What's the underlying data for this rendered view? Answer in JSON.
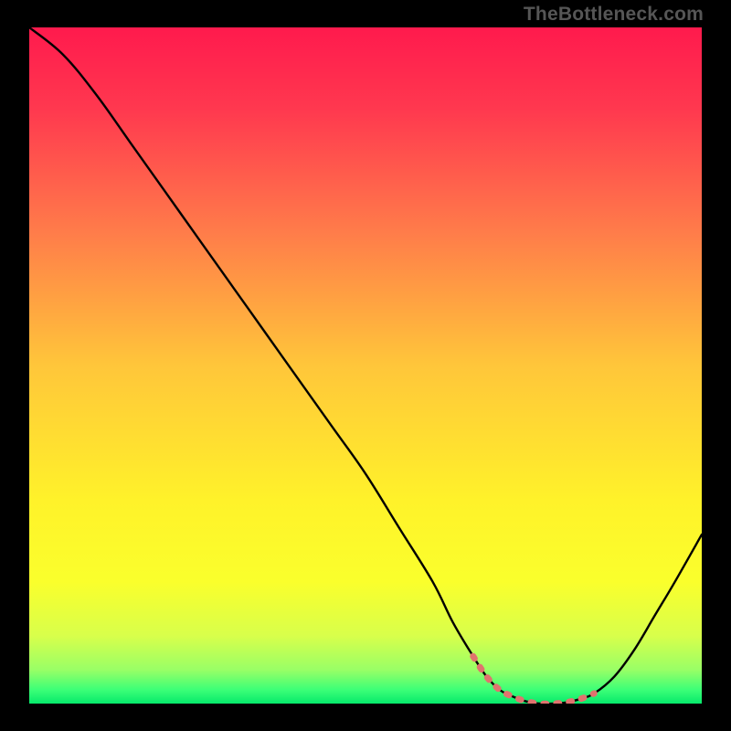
{
  "attribution": "TheBottleneck.com",
  "chart_data": {
    "type": "line",
    "title": "",
    "xlabel": "",
    "ylabel": "",
    "xlim": [
      0,
      100
    ],
    "ylim": [
      0,
      100
    ],
    "series": [
      {
        "name": "bottleneck-curve",
        "x": [
          0,
          5,
          10,
          15,
          20,
          25,
          30,
          35,
          40,
          45,
          50,
          55,
          60,
          63,
          66,
          68,
          70,
          72,
          74,
          76,
          78,
          80,
          82,
          84,
          87,
          90,
          93,
          96,
          100
        ],
        "y": [
          100,
          96,
          90,
          83,
          76,
          69,
          62,
          55,
          48,
          41,
          34,
          26,
          18,
          12,
          7,
          4,
          2,
          1,
          0.3,
          0,
          0,
          0.2,
          0.7,
          1.5,
          4,
          8,
          13,
          18,
          25
        ]
      },
      {
        "name": "highlight-band",
        "x": [
          66,
          68,
          70,
          72,
          74,
          76,
          78,
          80,
          82,
          84
        ],
        "y": [
          7,
          4,
          2,
          1,
          0.3,
          0,
          0,
          0.2,
          0.7,
          1.5
        ]
      }
    ],
    "gradient_stops": [
      {
        "offset": 0.0,
        "color": "#ff1a4d"
      },
      {
        "offset": 0.12,
        "color": "#ff384f"
      },
      {
        "offset": 0.3,
        "color": "#ff7b4a"
      },
      {
        "offset": 0.5,
        "color": "#ffc63a"
      },
      {
        "offset": 0.7,
        "color": "#fff22a"
      },
      {
        "offset": 0.82,
        "color": "#faff2c"
      },
      {
        "offset": 0.9,
        "color": "#d8ff4b"
      },
      {
        "offset": 0.95,
        "color": "#99ff66"
      },
      {
        "offset": 0.98,
        "color": "#3bff77"
      },
      {
        "offset": 1.0,
        "color": "#06e96b"
      }
    ],
    "highlight_color": "#e0736e"
  }
}
